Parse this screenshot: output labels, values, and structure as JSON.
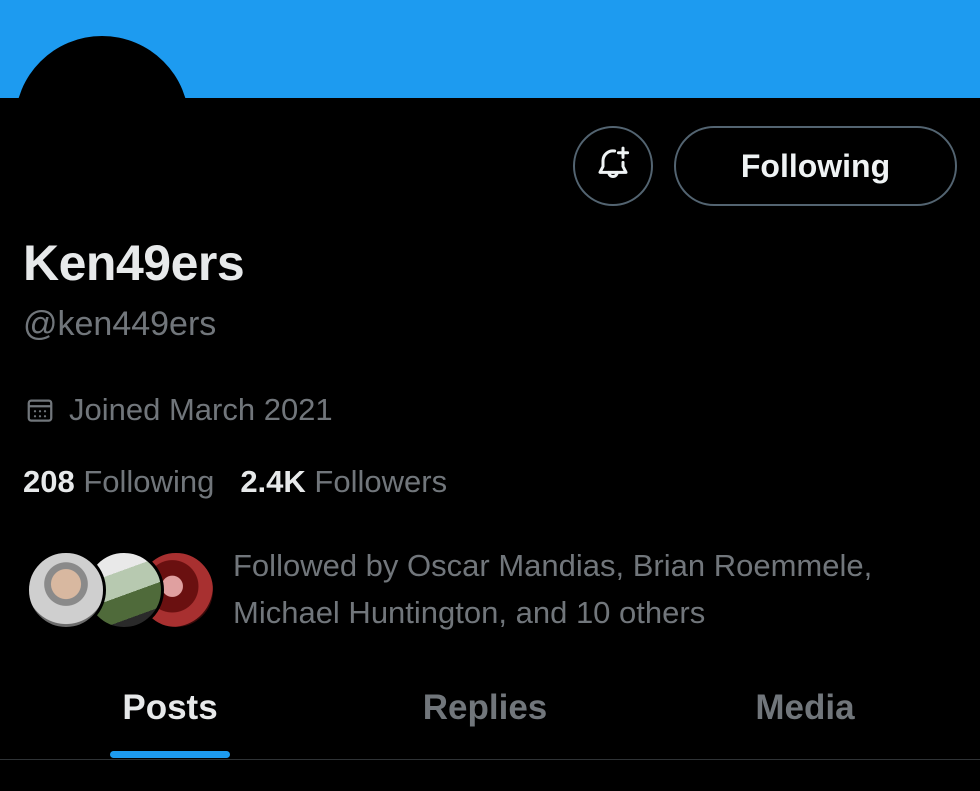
{
  "colors": {
    "accent": "#1d9bf0",
    "banner": "#1d9bf0",
    "background": "#000000",
    "muted": "#71767b",
    "text": "#e7e9ea"
  },
  "header": {
    "notify_icon": "bell-plus-icon",
    "follow_label": "Following"
  },
  "profile": {
    "display_name": "Ken49ers",
    "handle": "@ken449ers",
    "joined_icon": "calendar-icon",
    "joined": "Joined March 2021",
    "stats": {
      "following_count": "208",
      "following_label": "Following",
      "followers_count": "2.4K",
      "followers_label": "Followers"
    },
    "followed_by": "Followed by Oscar Mandias, Brian Roemmele, Michael Huntington, and 10 others"
  },
  "tabs": [
    {
      "label": "Posts",
      "active": true
    },
    {
      "label": "Replies",
      "active": false
    },
    {
      "label": "Media",
      "active": false
    }
  ]
}
